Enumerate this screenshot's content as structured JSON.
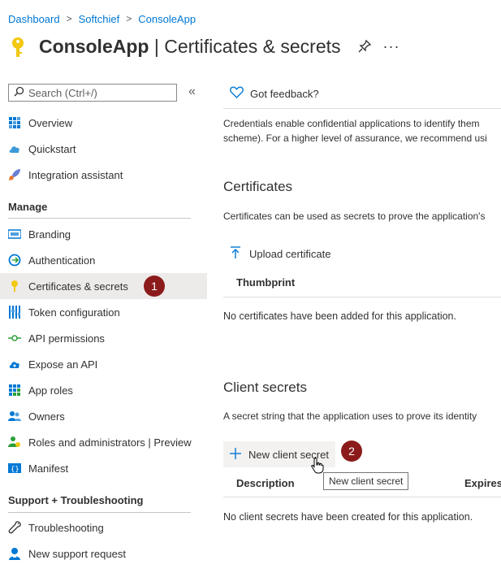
{
  "breadcrumb": [
    "Dashboard",
    "Softchief",
    "ConsoleApp"
  ],
  "header": {
    "app_name": "ConsoleApp",
    "separator": " | ",
    "page": "Certificates & secrets"
  },
  "sidebar": {
    "search_placeholder": "Search (Ctrl+/)",
    "items_top": [
      {
        "label": "Overview",
        "icon": "overview-grid-icon"
      },
      {
        "label": "Quickstart",
        "icon": "cloud-icon"
      },
      {
        "label": "Integration assistant",
        "icon": "rocket-icon"
      }
    ],
    "manage_heading": "Manage",
    "manage_items": [
      {
        "label": "Branding",
        "icon": "branding-icon"
      },
      {
        "label": "Authentication",
        "icon": "authentication-icon"
      },
      {
        "label": "Certificates & secrets",
        "icon": "key-icon",
        "active": true
      },
      {
        "label": "Token configuration",
        "icon": "token-bars-icon"
      },
      {
        "label": "API permissions",
        "icon": "api-permissions-icon"
      },
      {
        "label": "Expose an API",
        "icon": "cloud-api-icon"
      },
      {
        "label": "App roles",
        "icon": "app-roles-grid-icon"
      },
      {
        "label": "Owners",
        "icon": "owners-icon"
      },
      {
        "label": "Roles and administrators | Preview",
        "icon": "roles-admin-icon"
      },
      {
        "label": "Manifest",
        "icon": "manifest-icon"
      }
    ],
    "support_heading": "Support + Troubleshooting",
    "support_items": [
      {
        "label": "Troubleshooting",
        "icon": "wrench-icon"
      },
      {
        "label": "New support request",
        "icon": "support-person-icon"
      }
    ]
  },
  "badges": {
    "step1": "1",
    "step2": "2"
  },
  "main": {
    "feedback_label": "Got feedback?",
    "intro_line1": "Credentials enable confidential applications to identify them",
    "intro_line2": "scheme). For a higher level of assurance, we recommend usi",
    "certificates": {
      "heading": "Certificates",
      "description": "Certificates can be used as secrets to prove the application's",
      "upload_label": "Upload certificate",
      "col_thumbprint": "Thumbprint",
      "empty": "No certificates have been added for this application."
    },
    "client_secrets": {
      "heading": "Client secrets",
      "description": "A secret string that the application uses to prove its identity",
      "new_label": "New client secret",
      "tooltip": "New client secret",
      "col_description": "Description",
      "col_expires": "Expires",
      "empty": "No client secrets have been created for this application."
    }
  },
  "colors": {
    "accent": "#0078d4",
    "badge": "#8b1b1b",
    "key": "#f2c811"
  }
}
